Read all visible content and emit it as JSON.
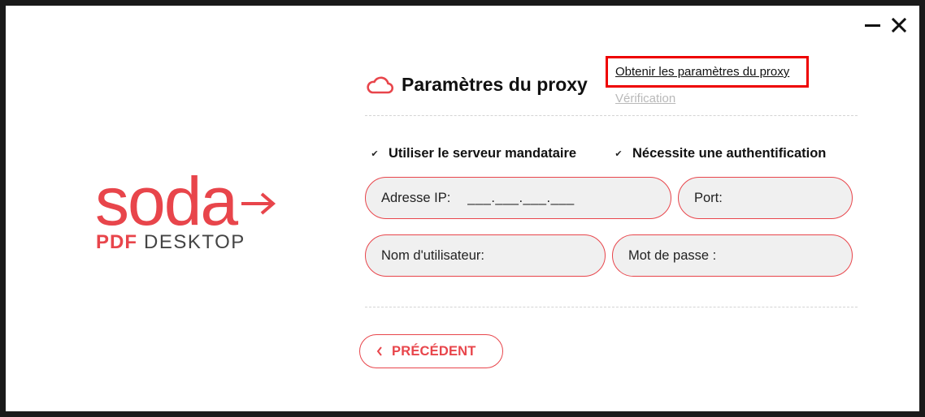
{
  "window": {
    "minimize_icon": "minimize-icon",
    "close_icon": "close-icon"
  },
  "logo": {
    "word": "soda",
    "line_bold": "PDF",
    "line_light": "DESKTOP",
    "arrow_icon": "arrow-right-icon"
  },
  "header": {
    "icon": "cloud-icon",
    "title": "Paramètres du proxy"
  },
  "links": {
    "get_settings": "Obtenir les paramètres du proxy",
    "verify": "Vérification"
  },
  "checkboxes": [
    {
      "label": "Utiliser le serveur mandataire",
      "checked": true
    },
    {
      "label": "Nécessite une authentification",
      "checked": true
    }
  ],
  "fields": {
    "ip_label": "Adresse IP:",
    "ip_value": "___.___.___.___",
    "port_label": "Port:",
    "user_label": "Nom d'utilisateur:",
    "password_label": "Mot de passe :"
  },
  "buttons": {
    "previous": "PRÉCÉDENT",
    "previous_icon": "chevron-left-icon"
  },
  "colors": {
    "accent": "#e8454b",
    "highlight": "#ee0000",
    "field_bg": "#f0f0f0",
    "disabled_link": "#b9b9b9"
  }
}
